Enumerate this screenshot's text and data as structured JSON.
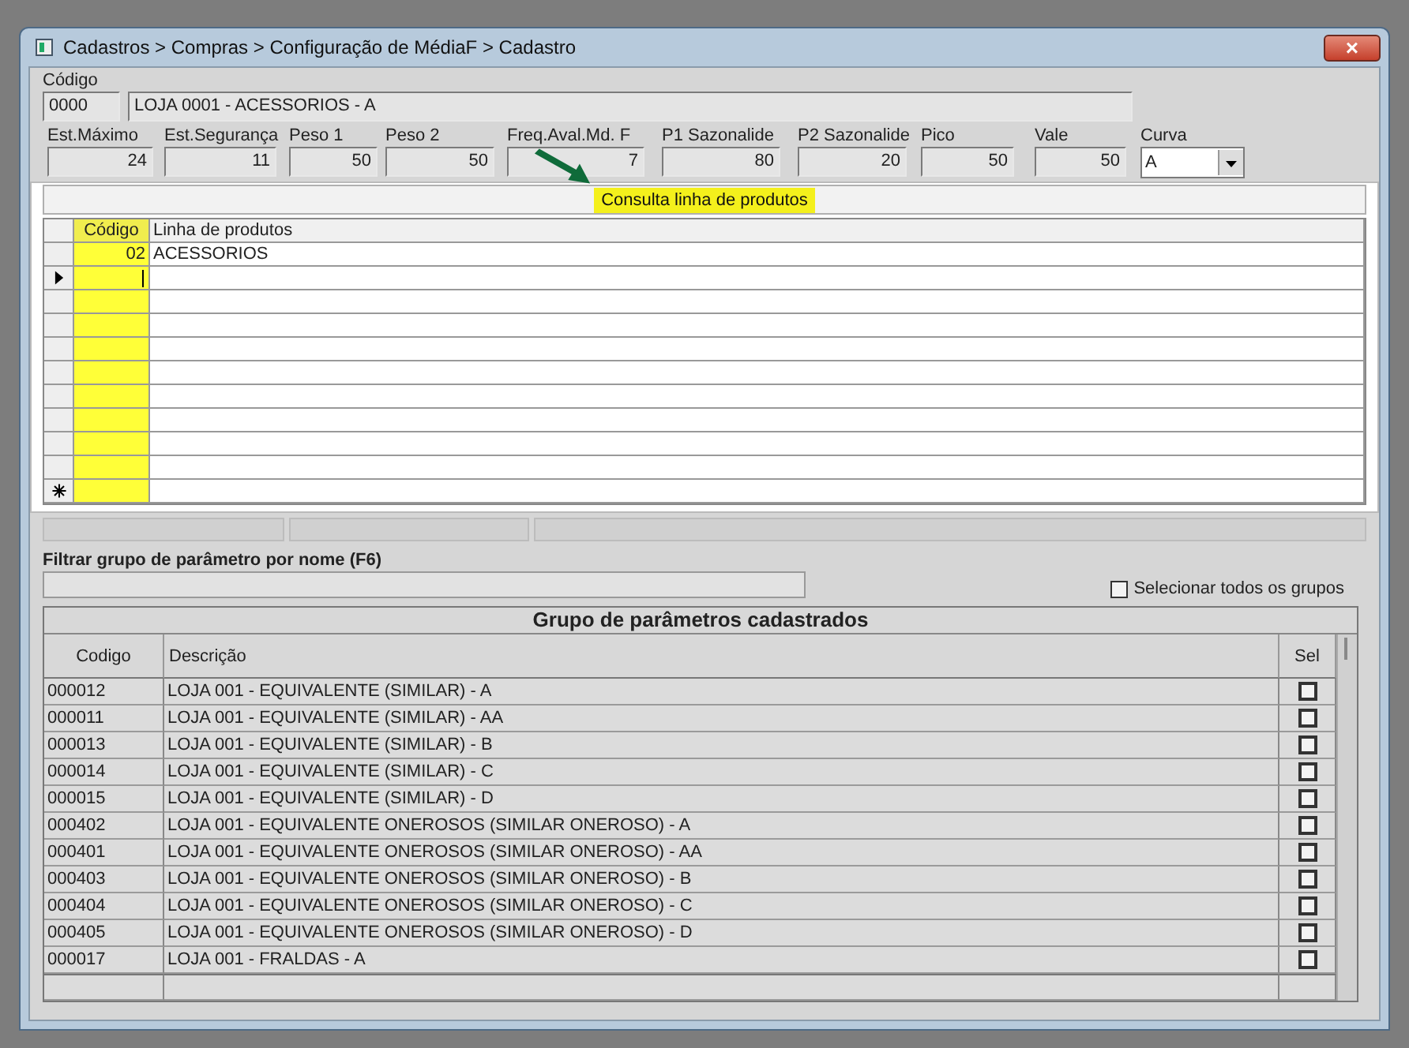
{
  "window": {
    "title": "Cadastros > Compras > Configuração de MédiaF > Cadastro",
    "close": "×"
  },
  "codigo": {
    "label": "Código",
    "code": "0000",
    "name": "LOJA 0001 - ACESSORIOS - A"
  },
  "params": [
    {
      "label": "Est.Máximo",
      "value": "24"
    },
    {
      "label": "Est.Segurança",
      "value": "11"
    },
    {
      "label": "Peso 1",
      "value": "50"
    },
    {
      "label": "Peso 2",
      "value": "50"
    },
    {
      "label": "Freq.Aval.Md. F",
      "value": "7"
    },
    {
      "label": "P1 Sazonalide",
      "value": "80"
    },
    {
      "label": "P2 Sazonalide",
      "value": "20"
    },
    {
      "label": "Pico",
      "value": "50"
    },
    {
      "label": "Vale",
      "value": "50"
    }
  ],
  "curva": {
    "label": "Curva",
    "value": "A"
  },
  "consulta": {
    "label": "Consulta linha de produtos"
  },
  "linhas": {
    "columns": [
      "Código",
      "Linha de produtos"
    ],
    "rows": [
      {
        "kind": "entry",
        "current": false,
        "codigo": "02",
        "linha": "ACESSORIOS"
      },
      {
        "kind": "entry",
        "current": true
      },
      {
        "kind": "entry",
        "current": false
      },
      {
        "kind": "entry",
        "current": false
      },
      {
        "kind": "entry",
        "current": false
      },
      {
        "kind": "entry",
        "current": false
      },
      {
        "kind": "entry",
        "current": false
      },
      {
        "kind": "entry",
        "current": false
      },
      {
        "kind": "entry",
        "current": false
      },
      {
        "kind": "entry",
        "current": false
      },
      {
        "kind": "new",
        "current": false
      }
    ]
  },
  "filtro": {
    "label": "Filtrar grupo de parâmetro por nome (F6)"
  },
  "selecionar_todos": {
    "label": "Selecionar todos os grupos",
    "checked": false
  },
  "grupos": {
    "title": "Grupo de parâmetros cadastrados",
    "columns": [
      "Codigo",
      "Descrição",
      "Sel"
    ],
    "rows": [
      {
        "codigo": "000012",
        "descricao": "LOJA 001 - EQUIVALENTE (SIMILAR) - A",
        "sel": false
      },
      {
        "codigo": "000011",
        "descricao": "LOJA 001 - EQUIVALENTE (SIMILAR) - AA",
        "sel": false
      },
      {
        "codigo": "000013",
        "descricao": "LOJA 001 - EQUIVALENTE (SIMILAR) - B",
        "sel": false
      },
      {
        "codigo": "000014",
        "descricao": "LOJA 001 - EQUIVALENTE (SIMILAR) - C",
        "sel": false
      },
      {
        "codigo": "000015",
        "descricao": "LOJA 001 - EQUIVALENTE (SIMILAR) - D",
        "sel": false
      },
      {
        "codigo": "000402",
        "descricao": "LOJA 001 - EQUIVALENTE ONEROSOS (SIMILAR ONEROSO) - A",
        "sel": false
      },
      {
        "codigo": "000401",
        "descricao": "LOJA 001 - EQUIVALENTE ONEROSOS (SIMILAR ONEROSO) - AA",
        "sel": false
      },
      {
        "codigo": "000403",
        "descricao": "LOJA 001 - EQUIVALENTE ONEROSOS (SIMILAR ONEROSO) - B",
        "sel": false
      },
      {
        "codigo": "000404",
        "descricao": "LOJA 001 - EQUIVALENTE ONEROSOS (SIMILAR ONEROSO) - C",
        "sel": false
      },
      {
        "codigo": "000405",
        "descricao": "LOJA 001 - EQUIVALENTE ONEROSOS (SIMILAR ONEROSO) - D",
        "sel": false
      },
      {
        "codigo": "000017",
        "descricao": "LOJA 001 - FRALDAS - A",
        "sel": false
      }
    ]
  }
}
